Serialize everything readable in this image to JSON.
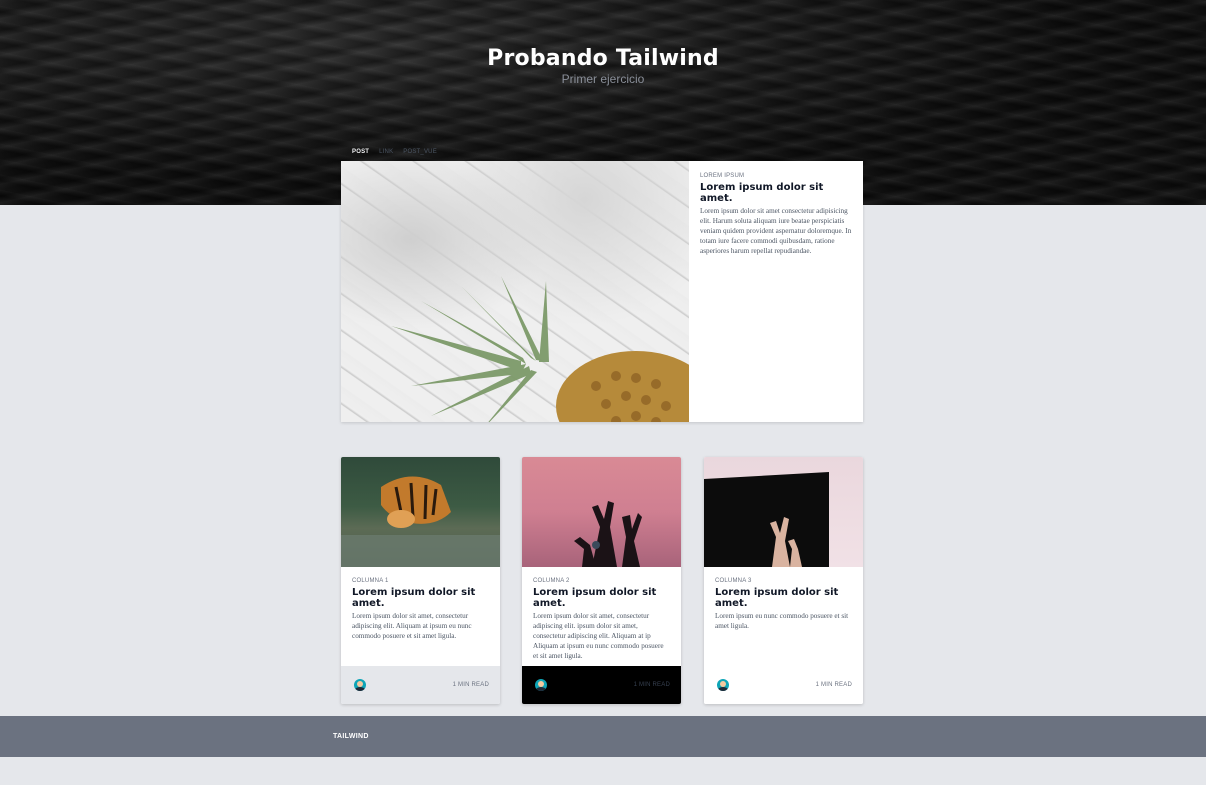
{
  "header": {
    "title": "Probando Tailwind",
    "subtitle": "Primer ejercicio"
  },
  "tabs": [
    {
      "label": "POST",
      "active": true
    },
    {
      "label": "LINK",
      "active": false
    },
    {
      "label": "POST_VUE",
      "active": false
    }
  ],
  "featured": {
    "category": "LOREM IPSUM",
    "title": "Lorem ipsum dolor sit amet.",
    "text": "Lorem ipsum dolor sit amet consectetur adipisicing elit. Harum soluta aliquam iure beatae perspiciatis veniam quidem provident aspernatur doloremque. In totam iure facere commodi quibusdam, ratione asperiores harum repellat repudiandae."
  },
  "cards": [
    {
      "category": "COLUMNA 1",
      "title": "Lorem ipsum dolor sit amet.",
      "text": "Lorem ipsum dolor sit amet, consectetur adipiscing elit. Aliquam at ipsum eu nunc commodo posuere et sit amet ligula.",
      "read": "1 MIN READ"
    },
    {
      "category": "COLUMNA 2",
      "title": "Lorem ipsum dolor sit amet.",
      "text": "Lorem ipsum dolor sit amet, consectetur adipiscing elit. ipsum dolor sit amet, consectetur adipiscing elit. Aliquam at ip Aliquam at ipsum eu nunc commodo posuere et sit amet ligula.",
      "read": "1 MIN READ"
    },
    {
      "category": "COLUMNA 3",
      "title": "Lorem ipsum dolor sit amet.",
      "text": "Lorem ipsum eu nunc commodo posuere et sit amet ligula.",
      "read": "1 MIN READ"
    }
  ],
  "footer": {
    "brand": "TAILWIND"
  },
  "colors": {
    "page_bg": "#e5e7eb",
    "footer_bg": "#6b7280",
    "card2_footer_bg": "#000000"
  },
  "icons": {
    "avatar": "avatar-icon"
  }
}
